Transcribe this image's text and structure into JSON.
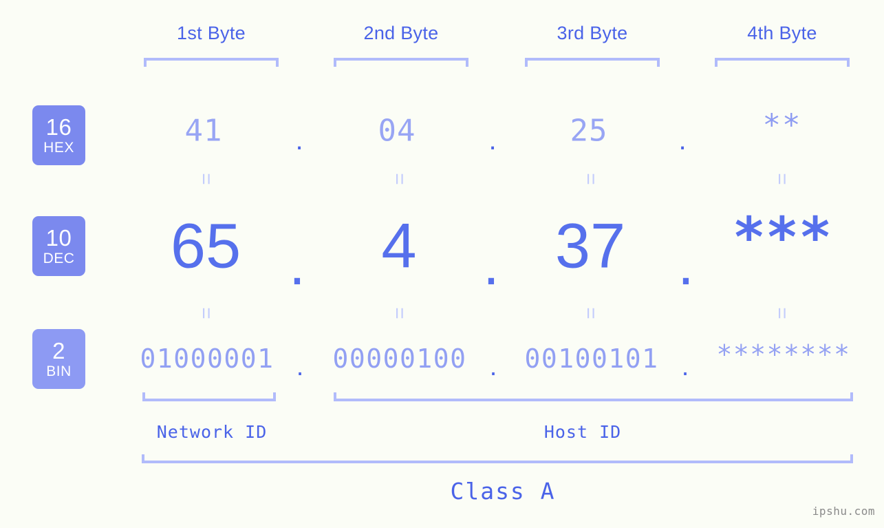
{
  "background_color": "#fbfdf6",
  "accent_color": "#4a63e8",
  "badge_color": "#7b89ee",
  "bracket_color": "#b1bbfb",
  "byte_headers": [
    {
      "label": "1st Byte"
    },
    {
      "label": "2nd Byte"
    },
    {
      "label": "3rd Byte"
    },
    {
      "label": "4th Byte"
    }
  ],
  "rows": [
    {
      "badge_num": "16",
      "badge_label": "HEX",
      "values": [
        "41",
        "04",
        "25",
        "**"
      ],
      "separator": "."
    },
    {
      "badge_num": "10",
      "badge_label": "DEC",
      "values": [
        "65",
        "4",
        "37",
        "***"
      ],
      "separator": "."
    },
    {
      "badge_num": "2",
      "badge_label": "BIN",
      "values": [
        "01000001",
        "00000100",
        "00100101",
        "********"
      ],
      "separator": "."
    }
  ],
  "equals_symbol": "=",
  "sections": [
    {
      "label": "Network ID"
    },
    {
      "label": "Host ID"
    }
  ],
  "class_label": "Class A",
  "watermark": "ipshu.com"
}
